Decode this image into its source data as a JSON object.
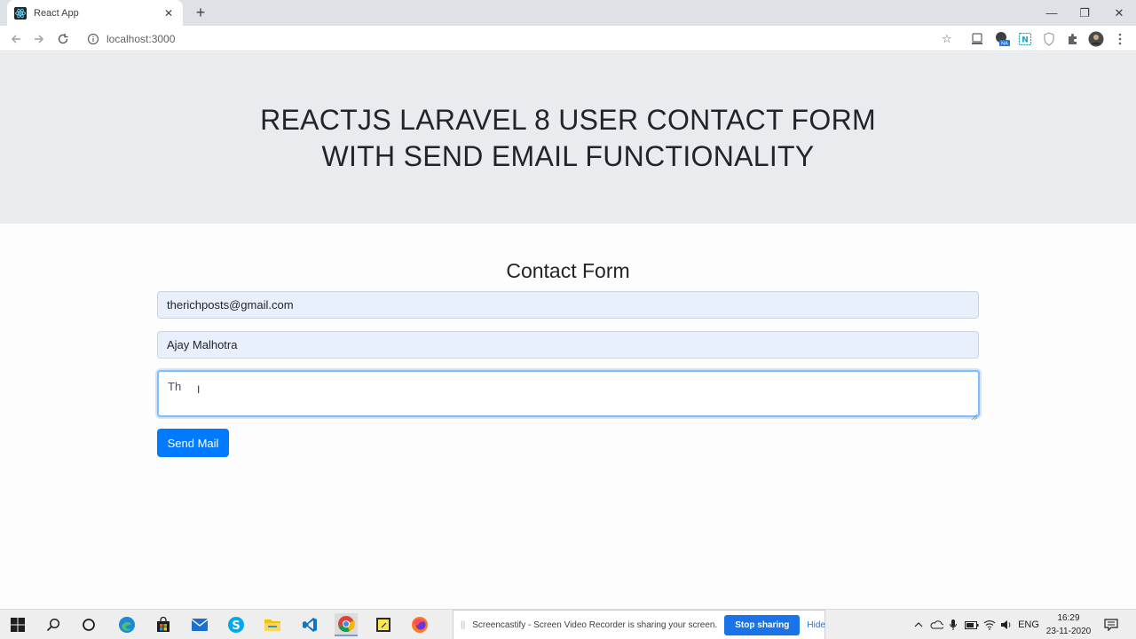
{
  "browser": {
    "tab_title": "React App",
    "tab_close": "✕",
    "new_tab": "+",
    "url": "localhost:3000",
    "minimize": "—",
    "restore": "❐",
    "close": "✕"
  },
  "page": {
    "heading": "REACTJS LARAVEL 8 USER CONTACT FORM WITH SEND EMAIL FUNCTIONALITY",
    "form_title": "Contact Form",
    "email_value": "therichposts@gmail.com",
    "name_value": "Ajay Malhotra",
    "message_value": "Th",
    "submit_label": "Send Mail"
  },
  "share_bar": {
    "message": "Screencastify - Screen Video Recorder is sharing your screen.",
    "stop_label": "Stop sharing",
    "hide_label": "Hide"
  },
  "taskbar": {
    "language": "ENG",
    "time": "16:29",
    "date": "23-11-2020"
  },
  "colors": {
    "primary": "#007bff",
    "jumbotron": "#e9ecef",
    "autofill": "#e8f0fe"
  }
}
